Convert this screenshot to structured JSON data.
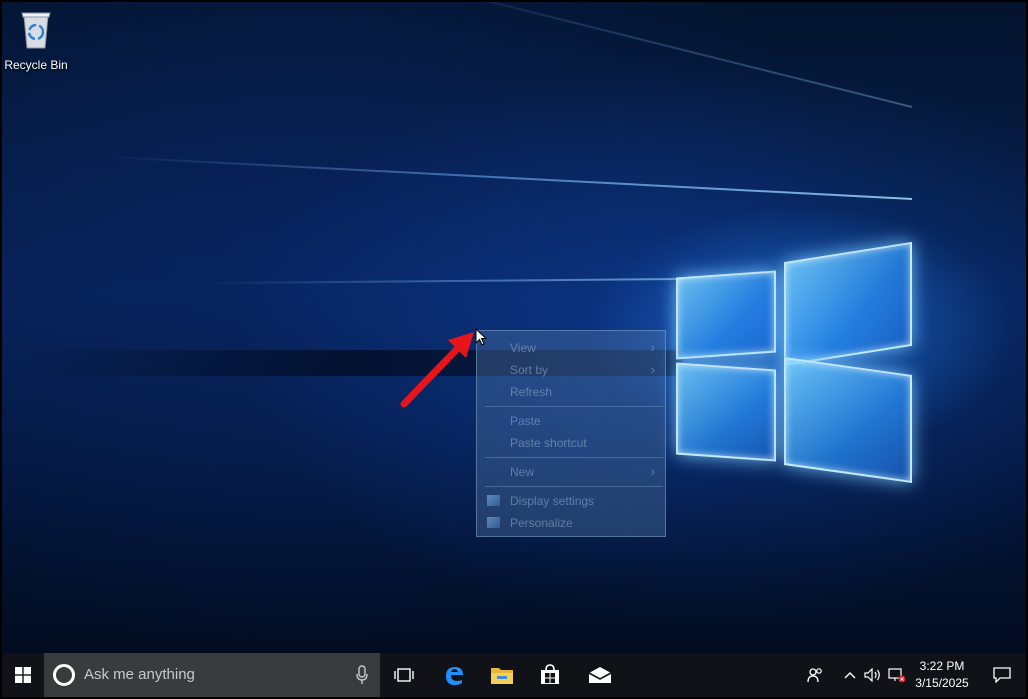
{
  "desktop": {
    "icons": [
      {
        "label": "Recycle Bin",
        "icon": "recycle-bin-icon"
      }
    ]
  },
  "context_menu": {
    "items": [
      {
        "label": "View",
        "submenu": true
      },
      {
        "label": "Sort by",
        "submenu": true
      },
      {
        "label": "Refresh",
        "submenu": false
      },
      {
        "label": "Paste",
        "submenu": false,
        "separator_before": true
      },
      {
        "label": "Paste shortcut",
        "submenu": false
      },
      {
        "label": "New",
        "submenu": true,
        "separator_before": true
      },
      {
        "label": "Display settings",
        "submenu": false,
        "icon": "display-icon",
        "separator_before": true
      },
      {
        "label": "Personalize",
        "submenu": false,
        "icon": "personalize-icon"
      }
    ],
    "submenu_arrow": "›"
  },
  "taskbar": {
    "search": {
      "placeholder": "Ask me anything"
    },
    "pinned": [
      "task-view-icon",
      "edge-icon",
      "file-explorer-icon",
      "store-icon",
      "mail-icon"
    ],
    "tray": {
      "icons": [
        "people-icon",
        "chevron-up-icon",
        "volume-icon",
        "network-disconnected-icon"
      ],
      "time": "3:22 PM",
      "date": "3/15/2025"
    }
  },
  "colors": {
    "taskbar": "#101218",
    "search_box": "#3a3b3d",
    "accent_arrow": "#e8141c",
    "wallpaper_light": "#5cc4ff"
  }
}
